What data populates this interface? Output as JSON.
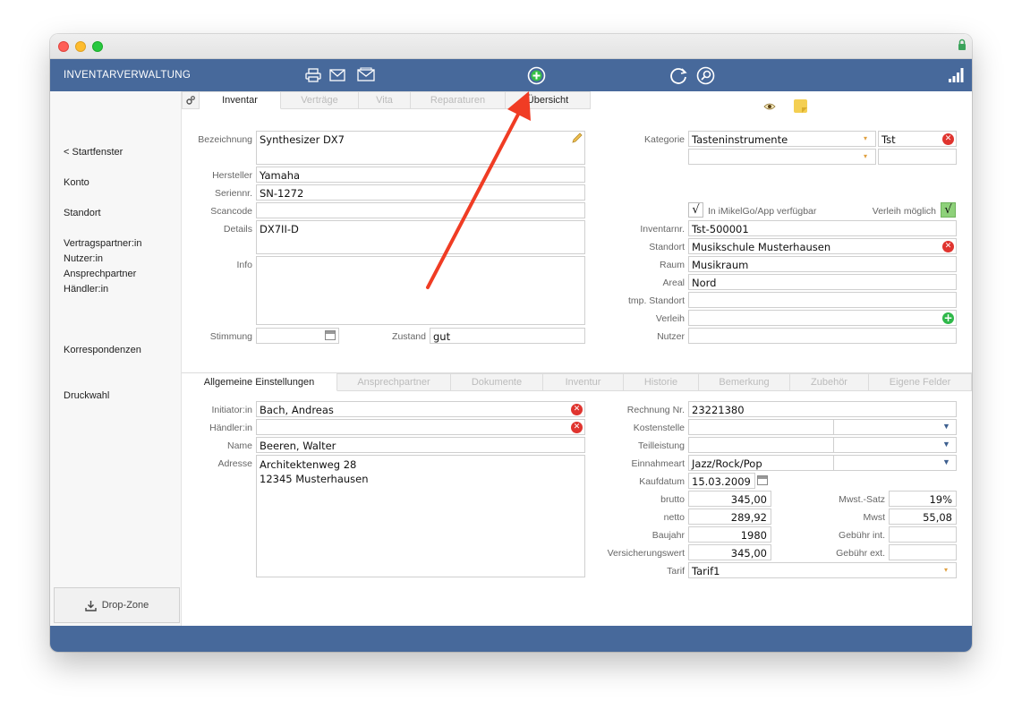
{
  "app": {
    "title": "INVENTARVERWALTUNG"
  },
  "sidebar": {
    "items": [
      {
        "label": "< Startfenster"
      },
      {
        "label": "Konto"
      },
      {
        "label": "Standort"
      },
      {
        "label": "Vertragspartner:in"
      },
      {
        "label": "Nutzer:in"
      },
      {
        "label": "Ansprechpartner"
      },
      {
        "label": "Händler:in"
      },
      {
        "label": "Korrespondenzen"
      },
      {
        "label": "Druckwahl"
      }
    ],
    "dropzone_label": "Drop-Zone"
  },
  "top_tabs": [
    {
      "label": "Inventar"
    },
    {
      "label": "Verträge"
    },
    {
      "label": "Vita"
    },
    {
      "label": "Reparaturen"
    },
    {
      "label": "Übersicht"
    }
  ],
  "form": {
    "bezeichnung": {
      "label": "Bezeichnung",
      "value": "Synthesizer DX7"
    },
    "hersteller": {
      "label": "Hersteller",
      "value": "Yamaha"
    },
    "seriennr": {
      "label": "Seriennr.",
      "value": "SN-1272"
    },
    "scancode": {
      "label": "Scancode",
      "value": ""
    },
    "details": {
      "label": "Details",
      "value": "DX7II-D"
    },
    "info": {
      "label": "Info",
      "value": ""
    },
    "stimmung": {
      "label": "Stimmung",
      "value": ""
    },
    "zustand": {
      "label": "Zustand",
      "value": "gut"
    },
    "kategorie": {
      "label": "Kategorie",
      "value": "Tasteninstrumente",
      "code": "Tst"
    },
    "app_available": {
      "label": "In iMikelGo/App verfügbar",
      "checked": true,
      "mark": "√"
    },
    "verleih_moeglich": {
      "label": "Verleih möglich",
      "checked": true,
      "mark": "√"
    },
    "inventarnr": {
      "label": "Inventarnr.",
      "value": "Tst-500001"
    },
    "standort": {
      "label": "Standort",
      "value": "Musikschule Musterhausen"
    },
    "raum": {
      "label": "Raum",
      "value": "Musikraum"
    },
    "areal": {
      "label": "Areal",
      "value": "Nord"
    },
    "tmp_standort": {
      "label": "tmp. Standort",
      "value": ""
    },
    "verleih": {
      "label": "Verleih",
      "value": ""
    },
    "nutzer": {
      "label": "Nutzer",
      "value": ""
    }
  },
  "bottom_tabs": [
    {
      "label": "Allgemeine Einstellungen"
    },
    {
      "label": "Ansprechpartner"
    },
    {
      "label": "Dokumente"
    },
    {
      "label": "Inventur"
    },
    {
      "label": "Historie"
    },
    {
      "label": "Bemerkung"
    },
    {
      "label": "Zubehör"
    },
    {
      "label": "Eigene Felder"
    }
  ],
  "general": {
    "initiator": {
      "label": "Initiator:in",
      "value": "Bach, Andreas"
    },
    "haendler": {
      "label": "Händler:in",
      "value": ""
    },
    "name": {
      "label": "Name",
      "value": "Beeren, Walter"
    },
    "adresse": {
      "label": "Adresse",
      "value": "Architektenweg 28\n12345 Musterhausen"
    },
    "rechnung_nr": {
      "label": "Rechnung Nr.",
      "value": "23221380"
    },
    "kostenstelle": {
      "label": "Kostenstelle",
      "value": ""
    },
    "teilleistung": {
      "label": "Teilleistung",
      "value": ""
    },
    "einnahmeart": {
      "label": "Einnahmeart",
      "value": "Jazz/Rock/Pop"
    },
    "kaufdatum": {
      "label": "Kaufdatum",
      "value": "15.03.2009"
    },
    "brutto": {
      "label": "brutto",
      "value": "345,00"
    },
    "netto": {
      "label": "netto",
      "value": "289,92"
    },
    "baujahr": {
      "label": "Baujahr",
      "value": "1980"
    },
    "versicherungswert": {
      "label": "Versicherungswert",
      "value": "345,00"
    },
    "tarif": {
      "label": "Tarif",
      "value": "Tarif1"
    },
    "mwst_satz": {
      "label": "Mwst.-Satz",
      "value": "19%"
    },
    "mwst": {
      "label": "Mwst",
      "value": "55,08"
    },
    "gebuehr_int": {
      "label": "Gebühr int.",
      "value": ""
    },
    "gebuehr_ext": {
      "label": "Gebühr ext.",
      "value": ""
    }
  },
  "colors": {
    "header": "#47699b",
    "annotation_arrow": "#f03c24"
  },
  "icons": [
    "printer-icon",
    "mail-icon",
    "mail-open-icon",
    "add-icon",
    "refresh-icon",
    "search-icon",
    "signal-icon",
    "gear-icon",
    "eye-icon",
    "note-icon",
    "pencil-icon",
    "download-icon",
    "lock-icon"
  ]
}
